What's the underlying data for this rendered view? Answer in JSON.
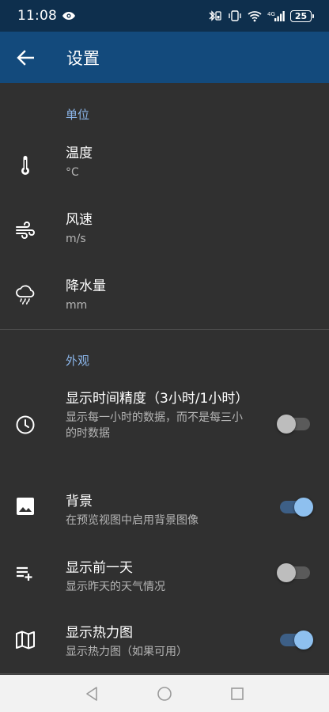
{
  "status_bar": {
    "time": "11:08",
    "battery": "25"
  },
  "app_bar": {
    "title": "设置"
  },
  "sections": {
    "units": {
      "header": "单位",
      "items": [
        {
          "title": "温度",
          "value": "°C"
        },
        {
          "title": "风速",
          "value": "m/s"
        },
        {
          "title": "降水量",
          "value": "mm"
        }
      ]
    },
    "appearance": {
      "header": "外观",
      "items": [
        {
          "title": "显示时间精度（3小时/1小时）",
          "subtitle": "显示每一小时的数据，而不是每三小的时数据",
          "enabled": false
        },
        {
          "title": "背景",
          "subtitle": "在预览视图中启用背景图像",
          "enabled": true
        },
        {
          "title": "显示前一天",
          "subtitle": "显示昨天的天气情况",
          "enabled": false
        },
        {
          "title": "显示热力图",
          "subtitle": "显示热力图（如果可用）",
          "enabled": true
        }
      ]
    }
  },
  "colors": {
    "status_bar": "#0e2f4d",
    "app_bar": "#134a7c",
    "background": "#303030",
    "accent": "#8ab4e8",
    "switch_on": "#8ec0ef"
  }
}
